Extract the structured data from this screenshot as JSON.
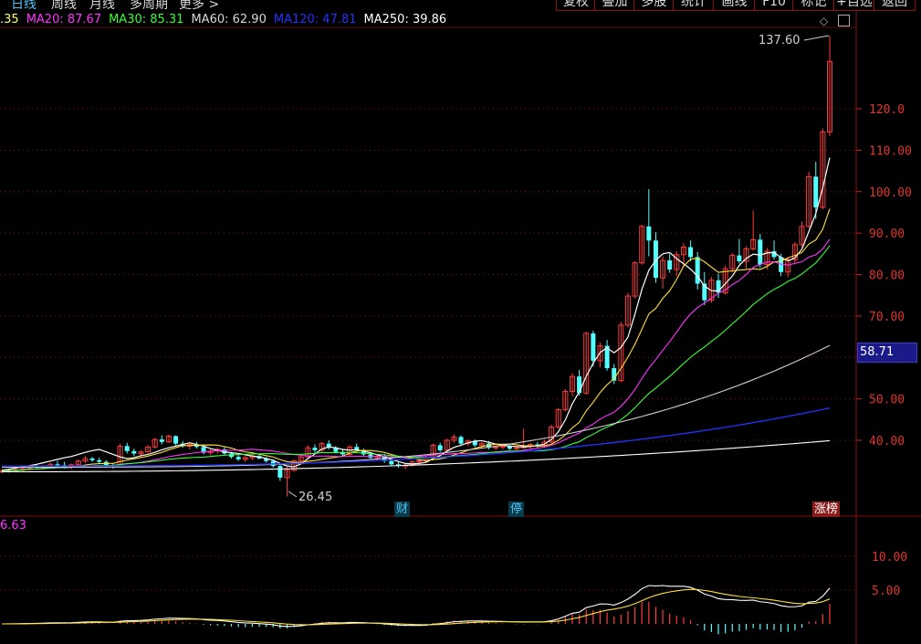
{
  "toolbar": {
    "periods": [
      {
        "label": "日线",
        "active": true
      },
      {
        "label": "周线",
        "active": false
      },
      {
        "label": "月线",
        "active": false
      },
      {
        "label": "多周期",
        "active": false
      },
      {
        "label": "更多 >",
        "active": false
      }
    ],
    "buttons": [
      "复权",
      "叠加",
      "多股",
      "统计",
      "画线",
      "F10",
      "标记",
      "+自选",
      "返回"
    ]
  },
  "ma_legend": [
    {
      "label": ".35",
      "color": "#ffff66"
    },
    {
      "label": "MA20: 87.67",
      "color": "#ff33ff"
    },
    {
      "label": "MA30: 85.31",
      "color": "#33ff33"
    },
    {
      "label": "MA60: 62.90",
      "color": "#d8d8d8"
    },
    {
      "label": "MA120: 47.81",
      "color": "#2233ff"
    },
    {
      "label": "MA250: 39.86",
      "color": "#ffffff"
    }
  ],
  "indicator_legend": {
    "label": "6.63",
    "color": "#ff33ff"
  },
  "current_price_label": "58.71",
  "max_annotation": "137.60",
  "min_annotation": "26.45",
  "event_tags": [
    {
      "label": "财",
      "color": "#4fc3f7",
      "bg": "#0b3a4a"
    },
    {
      "label": "停",
      "color": "#4fc3f7",
      "bg": "#0b3a4a"
    },
    {
      "label": "涨榜",
      "color": "#ffffff",
      "bg": "#8a1b1b"
    }
  ],
  "chart_data": {
    "type": "candlestick",
    "y_axis_ticks": [
      "120.0",
      "110.00",
      "100.00",
      "90.00",
      "80.00",
      "70.00",
      "50.00",
      "40.00"
    ],
    "y_axis_values": [
      120,
      110,
      100,
      90,
      80,
      70,
      50,
      40
    ],
    "ylim": [
      26,
      140
    ],
    "indicator_ticks": [
      "10.00",
      "5.00"
    ],
    "indicator_values": [
      10,
      5
    ],
    "indicator_ylim": [
      -3,
      13
    ],
    "candles": [
      [
        32.4,
        33.0,
        32.0,
        32.6
      ],
      [
        32.6,
        33.2,
        32.2,
        32.8
      ],
      [
        32.8,
        33.4,
        32.4,
        32.9
      ],
      [
        32.9,
        33.5,
        32.5,
        33.2
      ],
      [
        33.2,
        34.0,
        32.8,
        33.6
      ],
      [
        33.6,
        34.2,
        33.0,
        33.4
      ],
      [
        33.4,
        34.0,
        32.9,
        33.8
      ],
      [
        33.8,
        34.6,
        33.4,
        34.2
      ],
      [
        34.2,
        35.0,
        33.6,
        34.0
      ],
      [
        34.0,
        34.8,
        33.2,
        33.6
      ],
      [
        33.6,
        34.4,
        33.0,
        34.1
      ],
      [
        34.1,
        35.4,
        33.8,
        35.0
      ],
      [
        35.0,
        36.2,
        34.6,
        35.6
      ],
      [
        35.6,
        36.0,
        34.8,
        35.2
      ],
      [
        35.2,
        35.8,
        34.4,
        34.8
      ],
      [
        34.8,
        35.2,
        33.6,
        34.0
      ],
      [
        34.0,
        34.6,
        33.2,
        33.8
      ],
      [
        33.8,
        39.2,
        33.6,
        38.6
      ],
      [
        38.6,
        39.4,
        36.8,
        37.4
      ],
      [
        37.4,
        38.0,
        36.2,
        36.8
      ],
      [
        36.8,
        37.6,
        35.8,
        37.2
      ],
      [
        37.2,
        38.8,
        37.0,
        38.4
      ],
      [
        38.4,
        40.6,
        38.0,
        40.2
      ],
      [
        40.2,
        41.2,
        39.0,
        39.6
      ],
      [
        39.6,
        41.4,
        39.4,
        41.0
      ],
      [
        41.0,
        41.2,
        38.8,
        39.2
      ],
      [
        39.2,
        39.8,
        38.2,
        38.6
      ],
      [
        38.6,
        39.4,
        37.8,
        39.0
      ],
      [
        39.0,
        39.6,
        38.0,
        38.4
      ],
      [
        38.4,
        38.8,
        36.6,
        37.0
      ],
      [
        37.0,
        37.8,
        36.4,
        37.4
      ],
      [
        37.4,
        38.2,
        36.8,
        37.8
      ],
      [
        37.8,
        38.4,
        36.4,
        36.8
      ],
      [
        36.8,
        37.2,
        35.6,
        36.0
      ],
      [
        36.0,
        36.6,
        35.0,
        35.4
      ],
      [
        35.4,
        36.2,
        34.8,
        35.8
      ],
      [
        35.8,
        36.6,
        35.2,
        36.2
      ],
      [
        36.2,
        36.8,
        35.4,
        35.6
      ],
      [
        35.6,
        36.0,
        34.6,
        35.0
      ],
      [
        35.0,
        35.4,
        33.4,
        33.8
      ],
      [
        33.8,
        34.2,
        30.2,
        31.0
      ],
      [
        31.0,
        33.6,
        26.45,
        32.8
      ],
      [
        32.8,
        35.4,
        32.4,
        35.0
      ],
      [
        35.0,
        36.6,
        34.6,
        36.0
      ],
      [
        36.0,
        38.8,
        35.8,
        38.2
      ],
      [
        38.2,
        39.0,
        37.0,
        37.6
      ],
      [
        37.6,
        39.6,
        37.2,
        39.2
      ],
      [
        39.2,
        40.0,
        37.8,
        38.2
      ],
      [
        38.2,
        38.6,
        36.8,
        37.2
      ],
      [
        37.2,
        37.8,
        36.0,
        36.6
      ],
      [
        36.6,
        38.8,
        36.2,
        38.4
      ],
      [
        38.4,
        39.2,
        37.2,
        37.6
      ],
      [
        37.6,
        38.0,
        36.2,
        36.6
      ],
      [
        36.6,
        37.2,
        35.4,
        35.8
      ],
      [
        35.8,
        36.6,
        35.2,
        36.2
      ],
      [
        36.2,
        36.8,
        34.6,
        35.0
      ],
      [
        35.0,
        35.6,
        33.8,
        34.2
      ],
      [
        34.2,
        34.8,
        33.4,
        33.8
      ],
      [
        33.8,
        34.4,
        33.0,
        34.0
      ],
      [
        34.0,
        35.2,
        33.6,
        34.8
      ],
      [
        34.8,
        35.6,
        34.2,
        35.0
      ],
      [
        35.0,
        36.2,
        34.8,
        35.8
      ],
      [
        35.8,
        39.2,
        35.4,
        38.8
      ],
      [
        38.8,
        39.4,
        37.2,
        37.6
      ],
      [
        37.6,
        40.4,
        37.4,
        40.0
      ],
      [
        40.0,
        41.4,
        39.4,
        40.8
      ],
      [
        40.8,
        41.2,
        38.8,
        39.2
      ],
      [
        39.2,
        40.2,
        38.6,
        39.8
      ],
      [
        39.8,
        40.2,
        38.4,
        38.8
      ],
      [
        38.8,
        39.6,
        38.2,
        39.2
      ],
      [
        39.2,
        39.8,
        37.8,
        38.2
      ],
      [
        38.2,
        38.8,
        37.6,
        38.4
      ],
      [
        38.4,
        39.0,
        37.8,
        38.6
      ],
      [
        38.6,
        39.2,
        37.6,
        38.0
      ],
      [
        38.0,
        38.6,
        37.4,
        38.2
      ],
      [
        38.2,
        42.8,
        38.0,
        38.6
      ],
      [
        38.6,
        39.4,
        37.8,
        39.0
      ],
      [
        39.0,
        39.6,
        38.2,
        38.8
      ],
      [
        38.8,
        40.2,
        38.4,
        39.6
      ],
      [
        39.6,
        43.8,
        39.2,
        43.2
      ],
      [
        43.2,
        47.8,
        42.8,
        47.4
      ],
      [
        47.4,
        52.4,
        47.0,
        51.8
      ],
      [
        51.8,
        56.2,
        50.6,
        55.4
      ],
      [
        55.4,
        57.0,
        50.8,
        51.4
      ],
      [
        51.4,
        66.2,
        51.0,
        65.8
      ],
      [
        65.8,
        66.4,
        57.8,
        59.2
      ],
      [
        59.2,
        63.6,
        57.6,
        62.8
      ],
      [
        62.8,
        64.2,
        56.8,
        57.4
      ],
      [
        57.4,
        58.4,
        53.6,
        54.4
      ],
      [
        54.4,
        68.6,
        54.0,
        67.8
      ],
      [
        67.8,
        75.6,
        67.2,
        74.8
      ],
      [
        74.8,
        83.2,
        74.2,
        82.8
      ],
      [
        82.8,
        92.0,
        82.4,
        91.6
      ],
      [
        91.6,
        100.6,
        84.4,
        88.2
      ],
      [
        88.2,
        90.2,
        78.0,
        79.2
      ],
      [
        79.2,
        84.4,
        76.6,
        83.4
      ],
      [
        83.4,
        85.0,
        80.4,
        81.2
      ],
      [
        81.2,
        85.6,
        79.6,
        84.8
      ],
      [
        84.8,
        87.6,
        81.8,
        86.6
      ],
      [
        86.6,
        88.2,
        83.2,
        84.2
      ],
      [
        84.2,
        85.4,
        76.4,
        77.8
      ],
      [
        77.8,
        80.6,
        72.6,
        73.8
      ],
      [
        73.8,
        79.4,
        73.2,
        78.6
      ],
      [
        78.6,
        80.2,
        74.4,
        75.6
      ],
      [
        75.6,
        82.2,
        75.2,
        81.4
      ],
      [
        81.4,
        85.2,
        80.6,
        84.6
      ],
      [
        84.6,
        88.6,
        82.6,
        83.2
      ],
      [
        83.2,
        86.8,
        81.4,
        86.2
      ],
      [
        86.2,
        95.4,
        85.8,
        88.4
      ],
      [
        88.4,
        89.8,
        81.6,
        82.4
      ],
      [
        82.4,
        86.4,
        81.2,
        85.6
      ],
      [
        85.6,
        88.2,
        83.6,
        84.2
      ],
      [
        84.2,
        85.0,
        79.6,
        80.6
      ],
      [
        80.6,
        84.2,
        79.4,
        83.6
      ],
      [
        83.6,
        87.8,
        82.8,
        87.2
      ],
      [
        87.2,
        92.8,
        86.6,
        91.6
      ],
      [
        91.6,
        104.8,
        91.2,
        103.6
      ],
      [
        103.6,
        107.2,
        93.4,
        96.2
      ],
      [
        96.2,
        115.2,
        95.8,
        114.4
      ],
      [
        114.4,
        137.6,
        113.4,
        131.4
      ]
    ],
    "moving_averages": {
      "MA5": [
        32.8,
        33.0,
        33.3,
        33.6,
        33.9,
        34.2,
        34.6,
        35.0,
        35.4,
        35.8,
        36.1,
        36.6,
        37.1,
        37.5,
        37.8,
        37.2,
        36.6,
        36.0,
        35.6,
        35.8,
        36.3,
        36.6,
        37.1,
        37.7,
        38.2,
        38.6,
        39.0,
        39.4,
        39.0,
        38.6,
        38.0,
        37.6,
        37.2,
        37.0,
        36.8,
        36.5,
        36.2,
        36.0,
        35.6,
        35.2,
        34.4,
        33.8,
        33.6,
        34.3,
        35.6,
        36.7,
        37.9,
        38.4,
        38.2,
        37.8,
        37.6,
        37.7,
        37.4,
        37.0,
        36.5,
        36.0,
        35.4,
        34.9,
        34.4,
        34.3,
        34.4,
        34.7,
        35.6,
        36.3,
        37.4,
        38.3,
        38.8,
        39.4,
        39.8,
        39.9,
        39.5,
        39.1,
        38.8,
        38.6,
        38.5,
        38.4,
        38.5,
        38.7,
        39.1,
        40.2,
        42.1,
        44.9,
        48.8,
        51.7,
        55.4,
        58.6,
        61.2,
        62.3,
        61.1,
        62.4,
        64.9,
        70.4,
        76.4,
        81.0,
        83.4,
        85.0,
        85.3,
        83.8,
        82.6,
        81.3,
        79.6,
        77.2,
        76.1,
        76.0,
        77.8,
        79.6,
        82.2,
        83.9,
        84.9,
        84.7,
        85.2,
        85.3,
        84.1,
        83.3,
        84.0,
        86.1,
        90.4,
        94.7,
        100.9,
        108.2
      ]
    }
  }
}
